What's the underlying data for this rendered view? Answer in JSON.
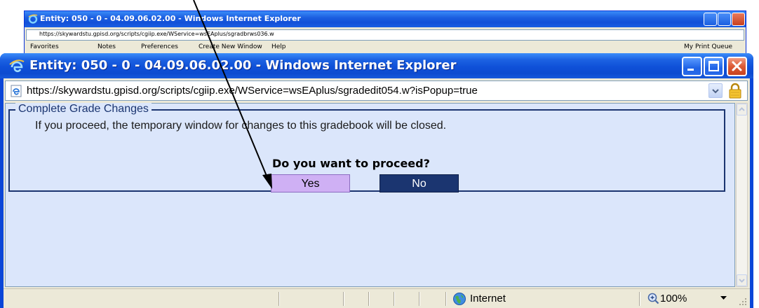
{
  "background_window": {
    "title": "Entity: 050 - 0 - 04.09.06.02.00 - Windows Internet Explorer",
    "url": "https://skywardstu.gpisd.org/scripts/cgiip.exe/WService=wsEAplus/sgradbrws036.w",
    "toolbar": [
      "Favorites",
      "Notes",
      "Preferences",
      "Create New Window",
      "Help",
      "My Print Queue"
    ]
  },
  "window": {
    "title": "Entity: 050 - 0 - 04.09.06.02.00 - Windows Internet Explorer",
    "controls": [
      "minimize-icon",
      "maximize-icon",
      "close-icon"
    ]
  },
  "address_bar": {
    "url": "https://skywardstu.gpisd.org/scripts/cgiip.exe/WService=wsEAplus/sgradedit054.w?isPopup=true",
    "icons": [
      "page-icon",
      "dropdown-icon",
      "lock-icon"
    ]
  },
  "dialog": {
    "legend": "Complete Grade Changes",
    "message": "If you proceed, the temporary window for changes to this gradebook will be closed.",
    "question": "Do you want to proceed?",
    "yes_label": "Yes",
    "no_label": "No"
  },
  "status_bar": {
    "zone": "Internet",
    "zoom": "100%",
    "icons": [
      "globe-icon",
      "zoom-icon",
      "resize-grip-icon"
    ]
  },
  "colors": {
    "titlebar": "#0f50d8",
    "content_bg": "#dbe6fb",
    "fieldset_border": "#1b3570",
    "yes_bg": "#cfb0f4",
    "no_bg": "#1b3570"
  }
}
